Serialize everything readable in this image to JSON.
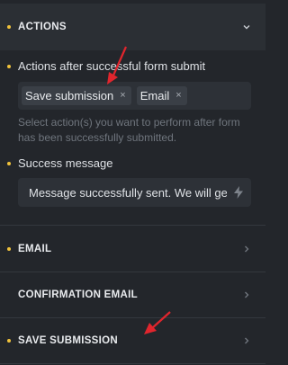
{
  "sections": {
    "actions": {
      "title": "ACTIONS",
      "expanded": true
    },
    "email": {
      "title": "EMAIL"
    },
    "confirmation": {
      "title": "CONFIRMATION EMAIL"
    },
    "save_submission": {
      "title": "SAVE SUBMISSION"
    }
  },
  "actions_field": {
    "label": "Actions after successful form submit",
    "tags": [
      {
        "label": "Save submission",
        "remove_glyph": "×"
      },
      {
        "label": "Email",
        "remove_glyph": "×"
      }
    ],
    "help_text": "Select action(s) you want to perform after form has been successfully submitted."
  },
  "success_message": {
    "label": "Success message",
    "value": "Message successfully sent. We will ge",
    "dynamic_icon": "bolt-icon"
  },
  "colors": {
    "background": "#23262b",
    "accent_bullet": "#f0c23b",
    "annotation_arrow": "#e0252d"
  }
}
